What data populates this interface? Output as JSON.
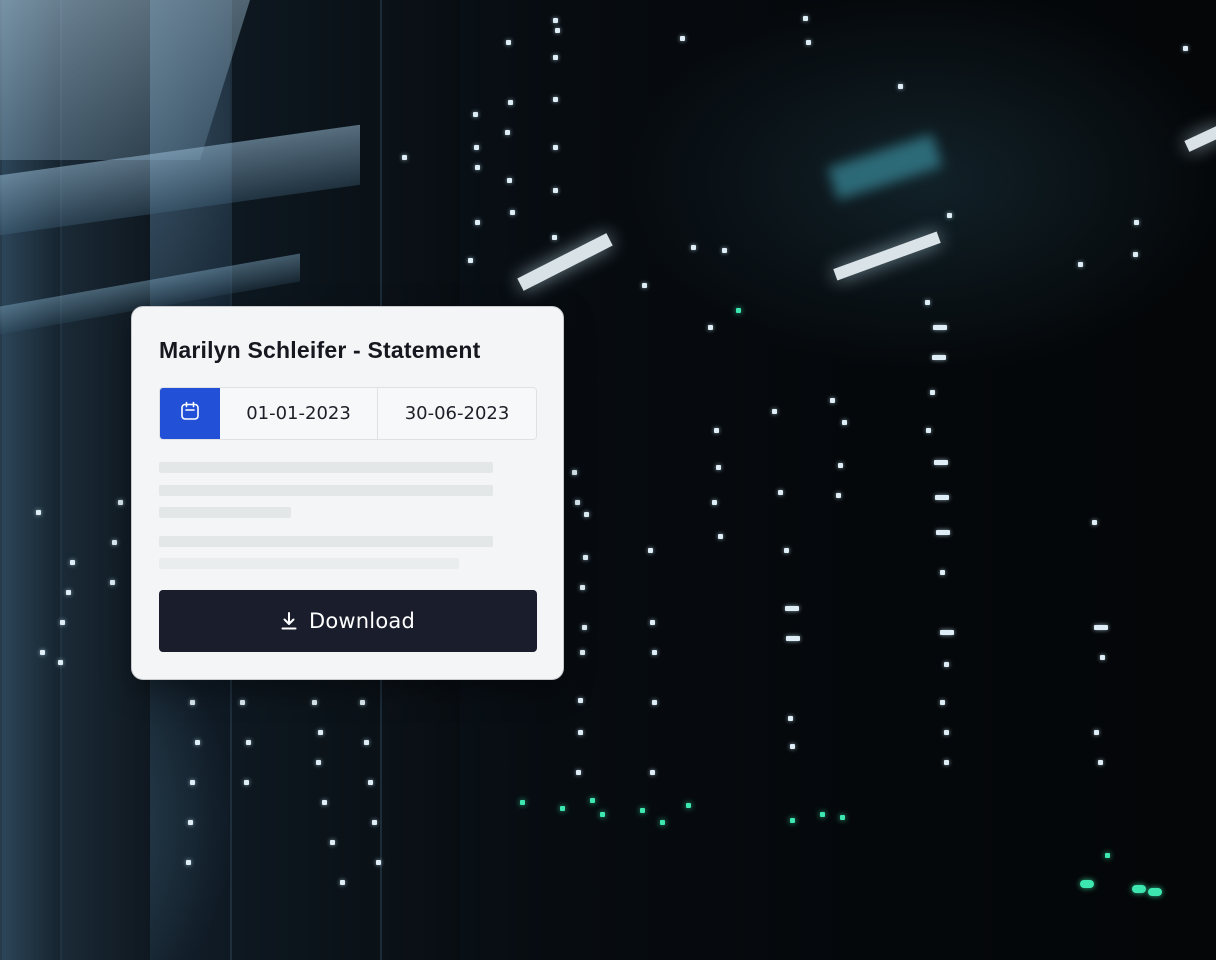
{
  "statement": {
    "title": "Marilyn Schleifer - Statement",
    "date_from": "01-01-2023",
    "date_to": "30-06-2023",
    "calendar_icon": "calendar-icon",
    "download_label": "Download",
    "download_icon": "download-icon"
  },
  "colors": {
    "accent": "#2251d8",
    "button_dark": "#1a1e2c",
    "card_bg": "#f4f5f6",
    "skeleton": "#e4e7e8"
  }
}
